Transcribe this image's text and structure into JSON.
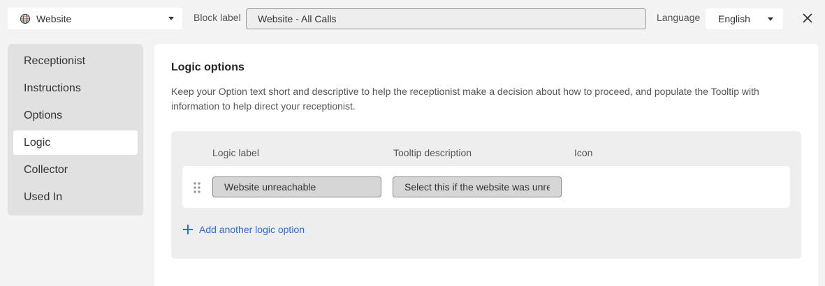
{
  "header": {
    "type_select": {
      "value": "Website",
      "icon": "globe-icon"
    },
    "block_label": {
      "label": "Block label",
      "value": "Website - All Calls"
    },
    "language": {
      "label": "Language",
      "value": "English"
    },
    "close_icon": "close-icon"
  },
  "sidebar": {
    "items": [
      {
        "label": "Receptionist",
        "active": false
      },
      {
        "label": "Instructions",
        "active": false
      },
      {
        "label": "Options",
        "active": false
      },
      {
        "label": "Logic",
        "active": true
      },
      {
        "label": "Collector",
        "active": false
      },
      {
        "label": "Used In",
        "active": false
      }
    ]
  },
  "main": {
    "title": "Logic options",
    "description": "Keep your Option text short and descriptive to help the receptionist make a decision about how to proceed, and populate the Tooltip with information to help direct your receptionist.",
    "columns": {
      "logic_label": "Logic label",
      "tooltip": "Tooltip description",
      "icon": "Icon"
    },
    "rows": [
      {
        "logic_label": "Website unreachable",
        "tooltip": "Select this if the website was unreachable"
      }
    ],
    "add_option": "Add another logic option"
  },
  "colors": {
    "accent": "#2f6bd6",
    "page_bg": "#f3f3f3",
    "sidebar_bg": "#e1e1e1",
    "panel_bg": "#eeeeee"
  }
}
